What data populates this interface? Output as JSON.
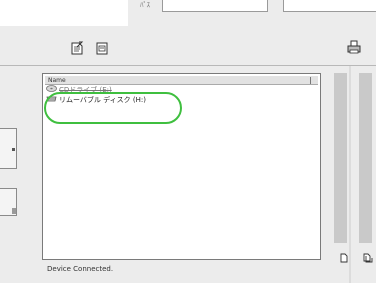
{
  "top": {
    "label": "ﾊﾟｽ"
  },
  "file_list": {
    "column_name": "Name",
    "items": [
      {
        "label": "CDドライブ (E:)",
        "icon": "cd-drive-icon",
        "struck": true
      },
      {
        "label": "リムーバブル ディスク (H:)",
        "icon": "removable-disk-icon",
        "struck": false
      }
    ]
  },
  "status": {
    "text": "Device Connected."
  },
  "icons": {
    "toolbar_left": "edit-document-icon",
    "toolbar_right": "preview-document-icon",
    "toolbar_far_right": "printer-icon",
    "bottom_a": "new-document-icon",
    "bottom_b": "copy-document-icon"
  },
  "colors": {
    "highlight": "#3fbf3f"
  }
}
